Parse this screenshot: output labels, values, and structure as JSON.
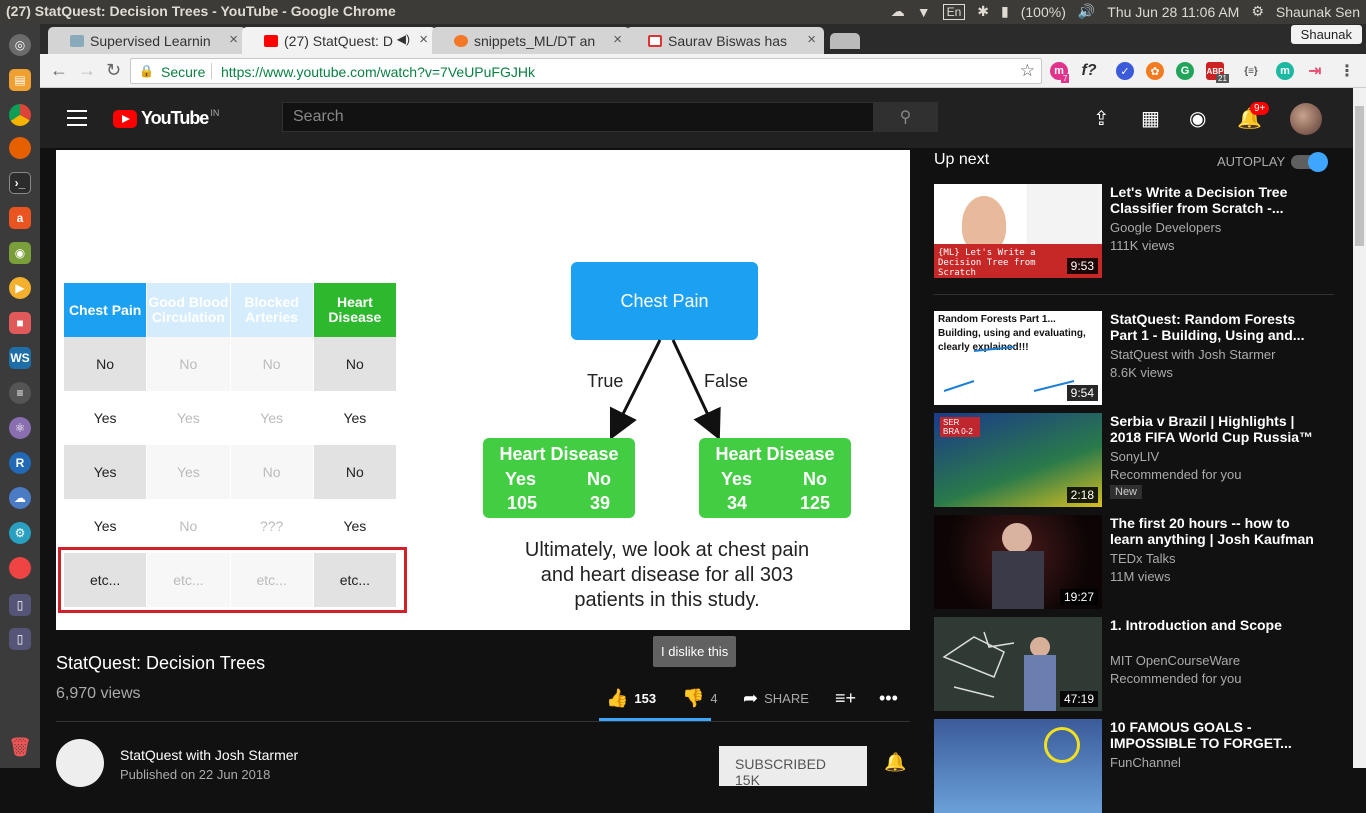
{
  "os": {
    "window_title": "(27) StatQuest: Decision Trees - YouTube - Google Chrome",
    "lang": "En",
    "battery": "(100%)",
    "datetime": "Thu Jun 28 11:06 AM",
    "user": "Shaunak Sen"
  },
  "tabs": [
    {
      "label": "Supervised Learnin",
      "close": "×"
    },
    {
      "label": "(27) StatQuest: D",
      "close": "×"
    },
    {
      "label": "snippets_ML/DT an",
      "close": "×"
    },
    {
      "label": "Saurav Biswas has",
      "close": "×"
    }
  ],
  "profile_name": "Shaunak",
  "omnibox": {
    "secure_label": "Secure",
    "url": "https://www.youtube.com/watch?v=7VeUPuFGJHk"
  },
  "extensions": {
    "abp_count": "21",
    "m_count": "7"
  },
  "yt": {
    "logo": "YouTube",
    "country": "IN",
    "search_placeholder": "Search",
    "notif_badge": "9+"
  },
  "slide": {
    "headers": [
      "Chest Pain",
      "Good Blood Circulation",
      "Blocked Arteries",
      "Heart Disease"
    ],
    "rows": [
      [
        "No",
        "No",
        "No",
        "No"
      ],
      [
        "Yes",
        "Yes",
        "Yes",
        "Yes"
      ],
      [
        "Yes",
        "Yes",
        "No",
        "No"
      ],
      [
        "Yes",
        "No",
        "???",
        "Yes"
      ],
      [
        "etc...",
        "etc...",
        "etc...",
        "etc..."
      ]
    ],
    "root": "Chest Pain",
    "edge_true": "True",
    "edge_false": "False",
    "leaf_left": {
      "title": "Heart Disease",
      "yes": "Yes",
      "no": "No",
      "yes_count": "105",
      "no_count": "39"
    },
    "leaf_right": {
      "title": "Heart Disease",
      "yes": "Yes",
      "no": "No",
      "yes_count": "34",
      "no_count": "125"
    },
    "caption": "Ultimately, we look at chest pain and heart disease for all 303 patients in this study."
  },
  "video": {
    "title": "StatQuest: Decision Trees",
    "views": "6,970 views",
    "likes": "153",
    "dislikes": "4",
    "share": "SHARE",
    "tooltip": "I dislike this"
  },
  "channel": {
    "name": "StatQuest with Josh Starmer",
    "published": "Published on 22 Jun 2018",
    "subscribe": "SUBSCRIBED  15K"
  },
  "upnext": {
    "label": "Up next",
    "autoplay": "AUTOPLAY"
  },
  "recommendations": [
    {
      "title": "Let's Write a Decision Tree Classifier from Scratch -...",
      "channel": "Google Developers",
      "meta": "111K views",
      "duration": "9:53",
      "thumb_text": "{ML} Let's Write a Decision Tree from Scratch"
    },
    {
      "title": "StatQuest: Random Forests Part 1 - Building, Using and...",
      "channel": "StatQuest with Josh Starmer",
      "meta": "8.6K views",
      "duration": "9:54",
      "thumb_text": "Random Forests Part 1... Building, using and evaluating, clearly explained!!!"
    },
    {
      "title": "Serbia v Brazil | Highlights | 2018 FIFA World Cup Russia™",
      "channel": "SonyLIV",
      "meta": "Recommended for you",
      "duration": "2:18",
      "badge": "New",
      "thumb_text": "SER BRA 0-2"
    },
    {
      "title": "The first 20 hours -- how to learn anything | Josh Kaufman ...",
      "channel": "TEDx Talks",
      "meta": "11M views",
      "duration": "19:27"
    },
    {
      "title": "1. Introduction and Scope",
      "channel": "MIT OpenCourseWare",
      "meta": "Recommended for you",
      "duration": "47:19"
    },
    {
      "title": "10 FAMOUS GOALS - IMPOSSIBLE TO FORGET...",
      "channel": "FunChannel",
      "meta": "",
      "duration": ""
    }
  ]
}
